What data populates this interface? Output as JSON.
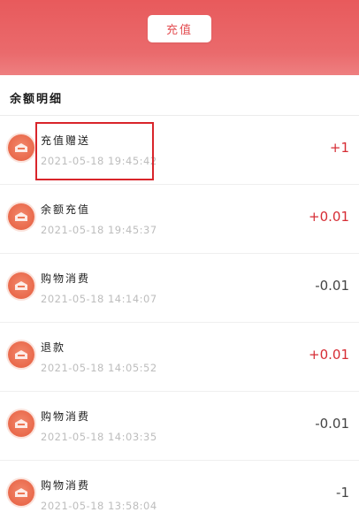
{
  "header": {
    "recharge_button_label": "充值",
    "accent_color": "#e85a5c"
  },
  "section": {
    "title": "余额明细"
  },
  "transactions": [
    {
      "title": "充值赠送",
      "time": "2021-05-18 19:45:42",
      "amount": "+1",
      "type": "positive",
      "icon": "wallet-icon"
    },
    {
      "title": "余额充值",
      "time": "2021-05-18 19:45:37",
      "amount": "+0.01",
      "type": "positive",
      "icon": "wallet-icon"
    },
    {
      "title": "购物消费",
      "time": "2021-05-18 14:14:07",
      "amount": "-0.01",
      "type": "negative",
      "icon": "wallet-icon"
    },
    {
      "title": "退款",
      "time": "2021-05-18 14:05:52",
      "amount": "+0.01",
      "type": "positive",
      "icon": "wallet-icon"
    },
    {
      "title": "购物消费",
      "time": "2021-05-18 14:03:35",
      "amount": "-0.01",
      "type": "negative",
      "icon": "wallet-icon"
    },
    {
      "title": "购物消费",
      "time": "2021-05-18 13:58:04",
      "amount": "-1",
      "type": "negative",
      "icon": "wallet-icon"
    }
  ],
  "colors": {
    "positive_amount": "#d62c34",
    "negative_amount": "#444444",
    "highlight_border": "#d9252b"
  }
}
